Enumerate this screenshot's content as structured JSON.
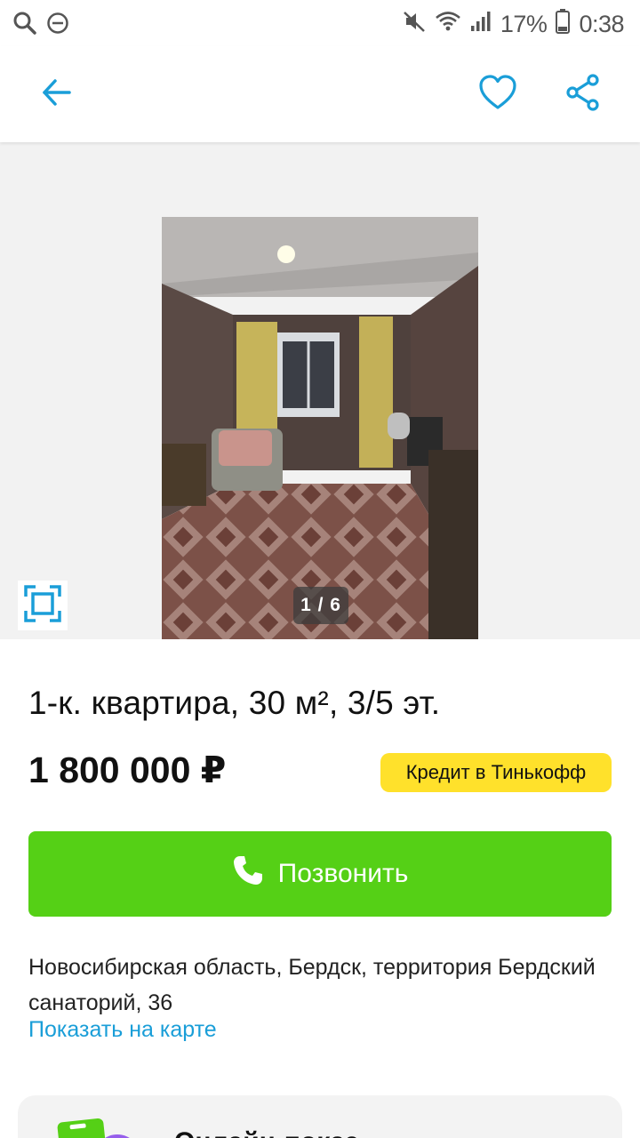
{
  "status_bar": {
    "battery": "17%",
    "time": "0:38"
  },
  "toolbar": {
    "back_icon": "arrow-left-icon",
    "favorite_icon": "heart-icon",
    "share_icon": "share-icon",
    "accent_color": "#1a9ed8"
  },
  "gallery": {
    "counter": "1 / 6"
  },
  "listing": {
    "title": "1-к. квартира, 30 м², 3/5 эт.",
    "price": "1 800 000 ₽",
    "credit_badge": "Кредит в Тинькофф",
    "call_button": "Позвонить",
    "address": "Новосибирская область, Бердск, территория Бердский санаторий, 36",
    "map_link": "Показать на карте"
  },
  "promo": {
    "title": "Онлайн-показ"
  },
  "colors": {
    "call_green": "#55d016",
    "badge_yellow": "#ffe12b",
    "link_blue": "#1a9ed8"
  }
}
